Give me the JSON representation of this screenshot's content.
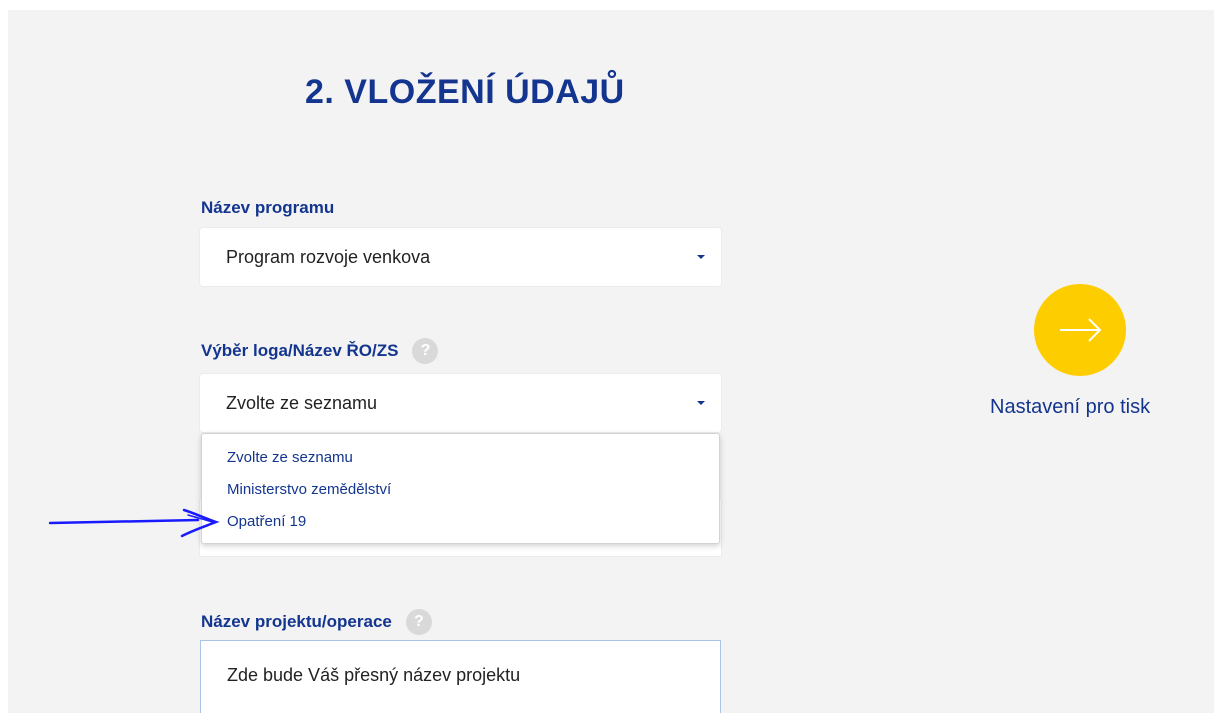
{
  "page": {
    "title": "2. VLOŽENÍ ÚDAJŮ"
  },
  "program": {
    "label": "Název programu",
    "value": "Program rozvoje venkova"
  },
  "logo": {
    "label": "Výběr loga/Název ŘO/ZS",
    "help": "?",
    "value": "Zvolte ze seznamu",
    "options": [
      "Zvolte ze seznamu",
      "Ministerstvo zemědělství",
      "Opatření 19"
    ]
  },
  "project": {
    "label": "Název projektu/operace",
    "help": "?",
    "value": "Zde bude Váš přesný název projektu"
  },
  "next": {
    "label": "Nastavení pro tisk",
    "icon": "arrow-right-icon"
  },
  "colors": {
    "accent": "#13358f",
    "button": "#fecd00",
    "background": "#f3f3f3",
    "annotation": "#1a1aff"
  }
}
